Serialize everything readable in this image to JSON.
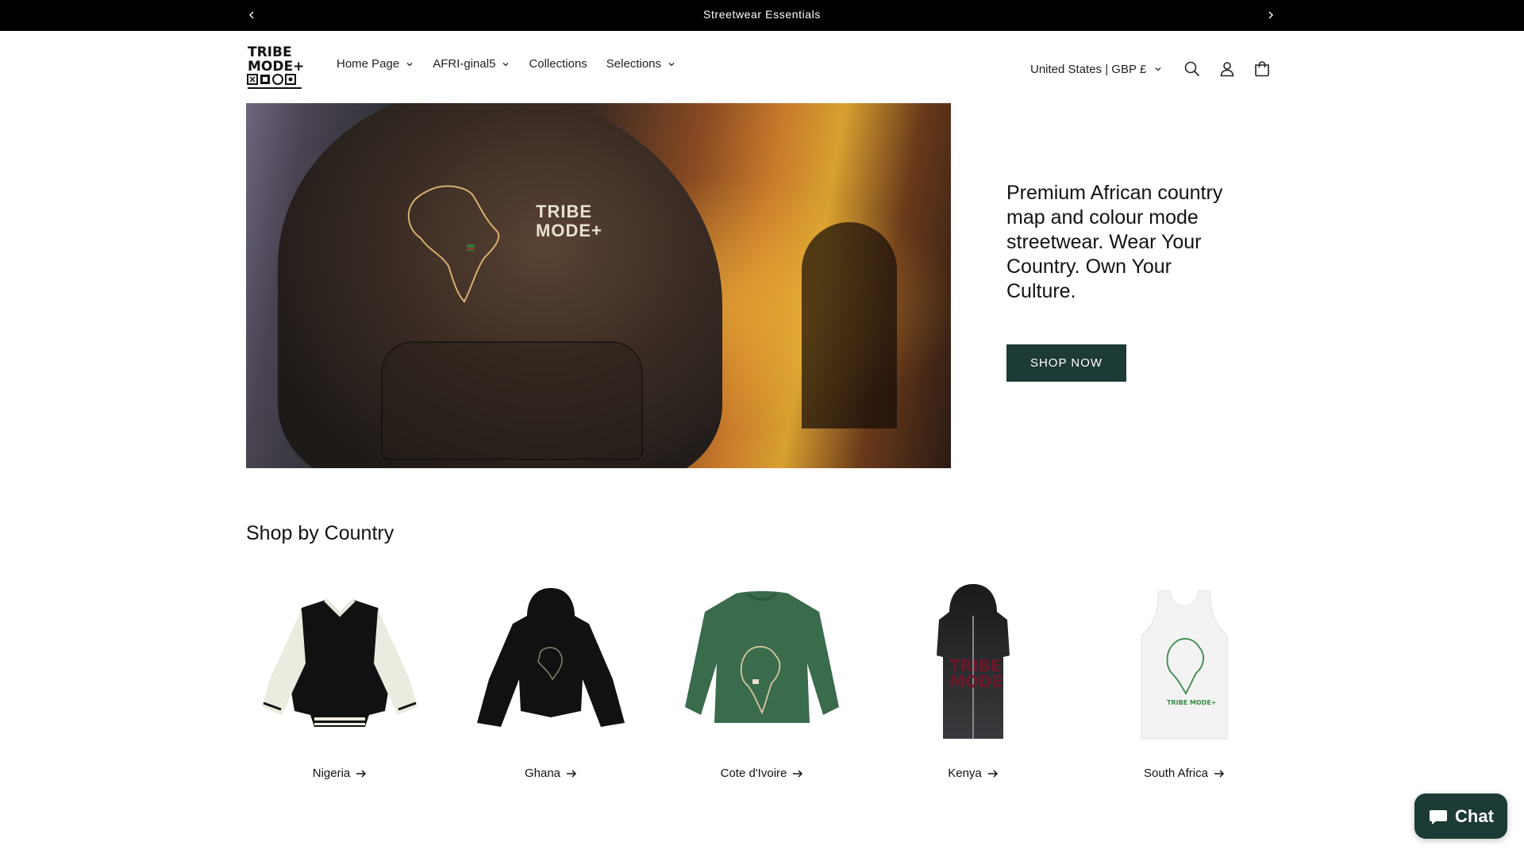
{
  "announcement": {
    "text": "Streetwear Essentials"
  },
  "header": {
    "logo_text": "TRIBE MODE+",
    "nav": [
      {
        "label": "Home Page",
        "has_dropdown": true
      },
      {
        "label": "AFRI-ginal5",
        "has_dropdown": true
      },
      {
        "label": "Collections",
        "has_dropdown": false
      },
      {
        "label": "Selections",
        "has_dropdown": true
      }
    ],
    "locale": "United States | GBP £",
    "icons": [
      "search-icon",
      "account-icon",
      "cart-icon"
    ]
  },
  "hero": {
    "text": "Premium African country map and colour mode streetwear. Wear Your Country. Own Your Culture.",
    "button": "SHOP NOW",
    "image_print": "TRIBE MODE+"
  },
  "shop_by_country": {
    "title": "Shop by Country",
    "items": [
      {
        "label": "Nigeria",
        "image": "varsity-jacket"
      },
      {
        "label": "Ghana",
        "image": "cropped-hoodie"
      },
      {
        "label": "Cote d'Ivoire",
        "image": "green-sweatshirt"
      },
      {
        "label": "Kenya",
        "image": "sleeveless-zip-hoodie"
      },
      {
        "label": "South Africa",
        "image": "white-tank-top"
      }
    ]
  },
  "chat": {
    "label": "Chat"
  },
  "colors": {
    "accent": "#1c3a36",
    "announcement_bg": "#000000"
  }
}
